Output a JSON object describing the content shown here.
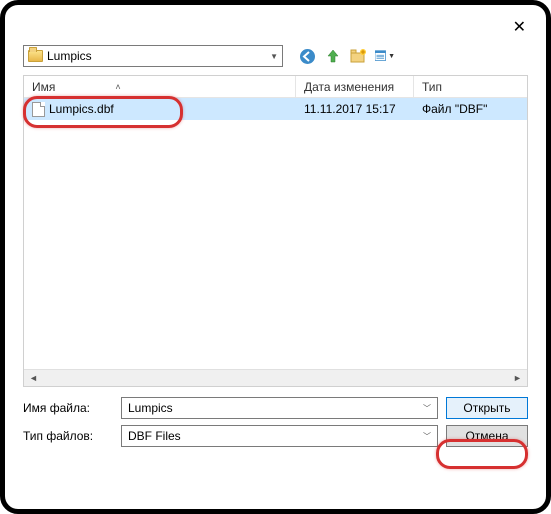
{
  "path": {
    "name": "Lumpics"
  },
  "columns": {
    "name": "Имя",
    "date": "Дата изменения",
    "type": "Тип"
  },
  "rows": [
    {
      "name": "Lumpics.dbf",
      "date": "11.11.2017 15:17",
      "type": "Файл \"DBF\""
    }
  ],
  "labels": {
    "filename": "Имя файла:",
    "filetype": "Тип файлов:"
  },
  "inputs": {
    "filename": "Lumpics",
    "filetype": "DBF Files"
  },
  "buttons": {
    "open": "Открыть",
    "cancel": "Отмена"
  }
}
